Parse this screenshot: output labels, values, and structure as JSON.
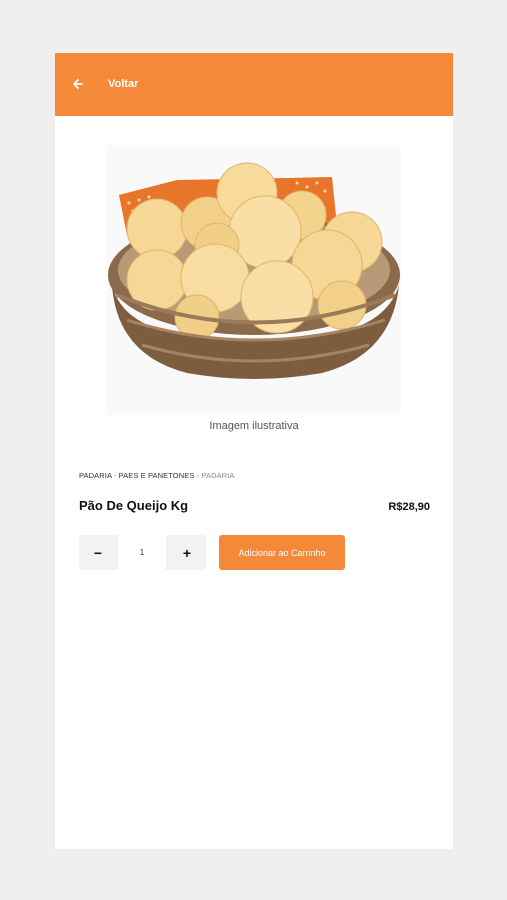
{
  "header": {
    "back_icon": "arrow-left-icon",
    "back_label": "Voltar",
    "color": "#f5893a"
  },
  "product": {
    "image_caption": "Imagem ilustrativa",
    "breadcrumb": [
      "PADARIA",
      "PAES E PANETONES",
      "PADARIA"
    ],
    "name": "Pão De Queijo Kg",
    "price": "R$28,90"
  },
  "cart": {
    "quantity": "1",
    "minus_label": "−",
    "plus_label": "+",
    "add_label": "Adicionar ao Carrinho"
  }
}
